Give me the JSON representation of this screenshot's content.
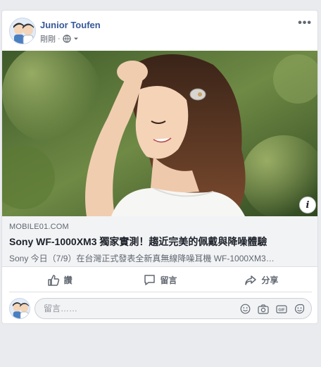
{
  "post": {
    "author": "Junior Toufen",
    "timestamp": "剛剛",
    "audience_icon": "globe-icon",
    "more_label": "•••"
  },
  "photo": {
    "info_label": "i"
  },
  "link_preview": {
    "domain": "MOBILE01.COM",
    "title": "Sony WF-1000XM3 獨家實測！趨近完美的佩戴與降噪體驗",
    "description": "Sony 今日（7/9）在台灣正式發表全新真無線降噪耳機 WF-1000XM3…"
  },
  "actions": {
    "like": "讚",
    "comment": "留言",
    "share": "分享"
  },
  "comment_box": {
    "placeholder": "留言……",
    "icons": [
      "emoji-icon",
      "camera-icon",
      "gif-icon",
      "sticker-icon"
    ]
  },
  "colors": {
    "author_link": "#365899",
    "secondary_text": "#606770",
    "background": "#e9ebee"
  }
}
